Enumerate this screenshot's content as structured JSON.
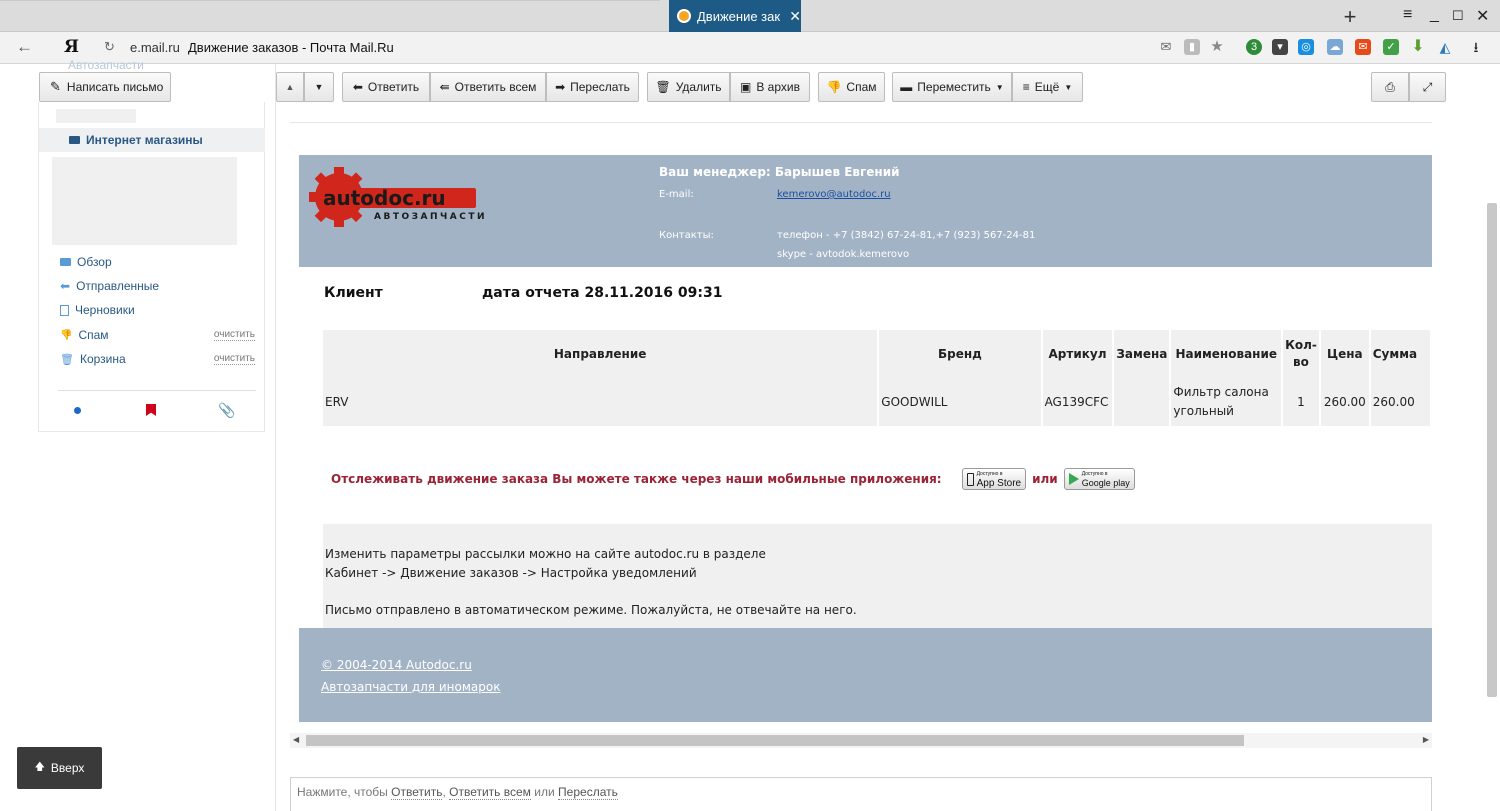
{
  "browser": {
    "tab_title": "Движение заказов - Почта Mail.Ru",
    "new_tab": "+",
    "url_domain": "e.mail.ru",
    "url_title": "Движение заказов - Почта Mail.Ru",
    "yandex_logo": "Я"
  },
  "toolbar": {
    "write": "Написать письмо",
    "reply": "Ответить",
    "reply_all": "Ответить всем",
    "forward": "Переслать",
    "delete": "Удалить",
    "archive": "В архив",
    "spam": "Спам",
    "move": "Переместить",
    "more": "Ещё"
  },
  "sidebar": {
    "faded_item": "Автозапчасти",
    "selected_folder": "Интернет магазины",
    "items": [
      {
        "label": "Обзор",
        "icon": "folder-icon"
      },
      {
        "label": "Отправленные",
        "icon": "reply-arrow-icon"
      },
      {
        "label": "Черновики",
        "icon": "draft-icon"
      },
      {
        "label": "Спам",
        "icon": "thumb-down-icon",
        "action": "очистить"
      },
      {
        "label": "Корзина",
        "icon": "trash-icon",
        "action": "очистить"
      }
    ]
  },
  "letter": {
    "logo_text": "autodoc.ru",
    "logo_sub": "АВТОЗАПЧАСТИ",
    "manager": "Ваш менеджер: Барышев Евгений",
    "email_label": "E-mail:",
    "email": "kemerovo@autodoc.ru",
    "contacts_label": "Контакты:",
    "phone": "телефон - +7 (3842) 67-24-81,+7 (923) 567-24-81",
    "skype": "skype - avtodok.kemerovo",
    "client_label": "Клиент",
    "report_date": "дата отчета 28.11.2016 09:31",
    "table": {
      "headers": [
        "Направление",
        "Бренд",
        "Артикул",
        "Замена",
        "Наименование",
        "Кол-во",
        "Цена",
        "Сумма"
      ],
      "rows": [
        [
          "ERV",
          "GOODWILL",
          "AG139CFC",
          "",
          "Фильтр салона угольный",
          "1",
          "260.00",
          "260.00"
        ]
      ]
    },
    "track_text": "Отслеживать движение заказа Вы можете также через наши мобильные приложения:",
    "track_or": "или",
    "appstore_small": "Доступно в",
    "appstore": "App Store",
    "googleplay_small": "Доступно в",
    "googleplay": "Google play",
    "info_line1": "Изменить параметры рассылки можно на сайте autodoc.ru в разделе",
    "info_line2": "Кабинет -> Движение заказов -> Настройка уведомлений",
    "info_line3": "Письмо отправлено в автоматическом режиме. Пожалуйста, не отвечайте на него.",
    "footer_copy": "© 2004-2014 Autodoc.ru",
    "footer_link": "Автозапчасти для иномарок"
  },
  "reply_bar": {
    "prefix": "Нажмите, чтобы",
    "reply": "Ответить",
    "sep": ",",
    "reply_all": "Ответить всем",
    "or": "или",
    "forward": "Переслать"
  },
  "up_button": "Вверх",
  "colors": {
    "tab_active": "#1d5a86",
    "letter_header": "#a3b3c6",
    "link_blue": "#2a5885",
    "track_red": "#9b2335"
  }
}
